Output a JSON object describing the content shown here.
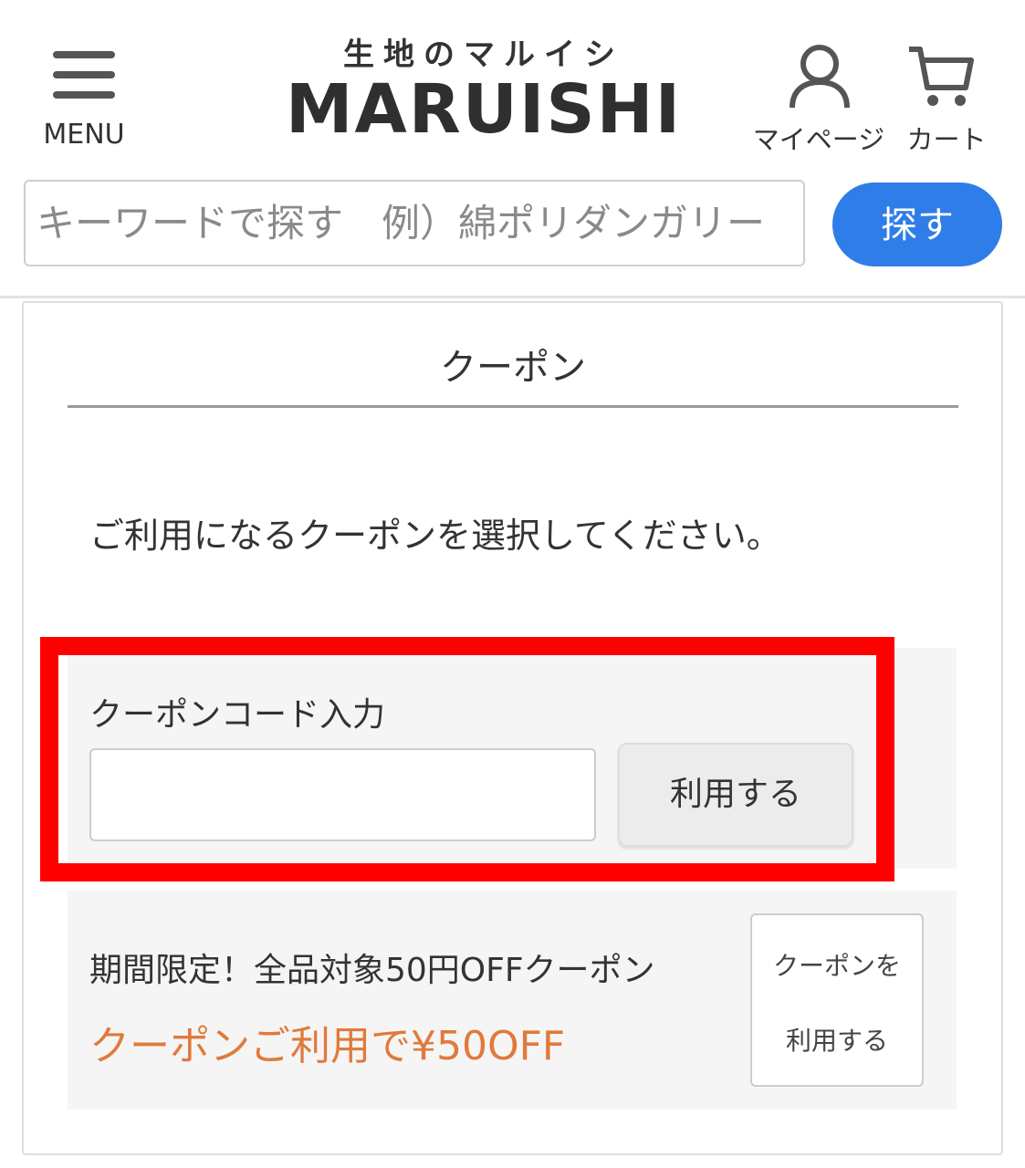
{
  "header": {
    "menu_label": "MENU",
    "logo_top": "生地のマルイシ",
    "logo_main": "MARUISHI",
    "mypage_label": "マイページ",
    "cart_label": "カート"
  },
  "search": {
    "placeholder": "キーワードで探す　例）綿ポリダンガリー",
    "button_label": "探す"
  },
  "coupon_panel": {
    "title": "クーポン",
    "instruction": "ご利用になるクーポンを選択してください。",
    "code_entry": {
      "label": "クーポンコード入力",
      "input_value": "",
      "apply_label": "利用する"
    },
    "coupons": [
      {
        "name": "期間限定！全品対象50円OFFクーポン",
        "discount": "クーポンご利用で¥50OFF",
        "use_label_line1": "クーポンを",
        "use_label_line2": "利用する"
      }
    ]
  },
  "colors": {
    "accent_blue": "#2f7de8",
    "discount_orange": "#e07a3c",
    "highlight_red": "#ff0000",
    "panel_bg": "#f5f5f5"
  },
  "icons": [
    "menu-icon",
    "user-icon",
    "cart-icon"
  ]
}
